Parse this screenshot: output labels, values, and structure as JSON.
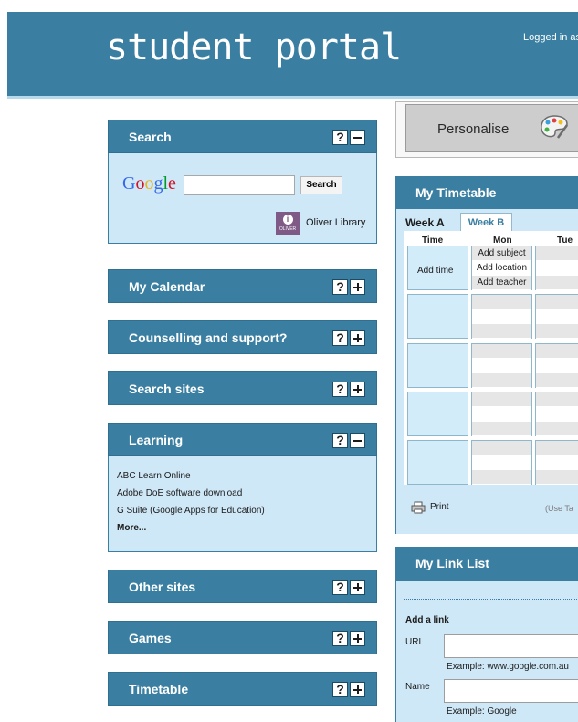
{
  "header": {
    "logo": "student portal",
    "login_text": "Logged in as"
  },
  "widgets": {
    "search": {
      "title": "Search",
      "google_label": "Google",
      "search_button": "Search",
      "library_logo_text": "OLIVER",
      "library_link": "Oliver Library"
    },
    "calendar": {
      "title": "My Calendar"
    },
    "counselling": {
      "title": "Counselling and support?"
    },
    "search_sites": {
      "title": "Search sites"
    },
    "learning": {
      "title": "Learning",
      "links": [
        "ABC Learn Online",
        "Adobe DoE software download",
        "G Suite (Google Apps for Education)"
      ],
      "more": "More..."
    },
    "other_sites": {
      "title": "Other sites"
    },
    "games": {
      "title": "Games"
    },
    "timetable": {
      "title": "Timetable"
    },
    "help_symbol": "?"
  },
  "personalise": {
    "label": "Personalise"
  },
  "my_timetable": {
    "title": "My Timetable",
    "week_a": "Week A",
    "week_b": "Week B",
    "columns": [
      "Time",
      "Mon",
      "Tue"
    ],
    "add_time": "Add time",
    "add_subject": "Add subject",
    "add_location": "Add location",
    "add_teacher": "Add teacher",
    "print": "Print",
    "hint": "(Use Ta"
  },
  "link_list": {
    "title": "My Link List",
    "add_link": "Add a link",
    "url_label": "URL",
    "url_example": "Example: www.google.com.au",
    "name_label": "Name",
    "name_example": "Example: Google"
  },
  "colors": {
    "accent": "#3a7fa1",
    "panel": "#cfe8f7"
  }
}
